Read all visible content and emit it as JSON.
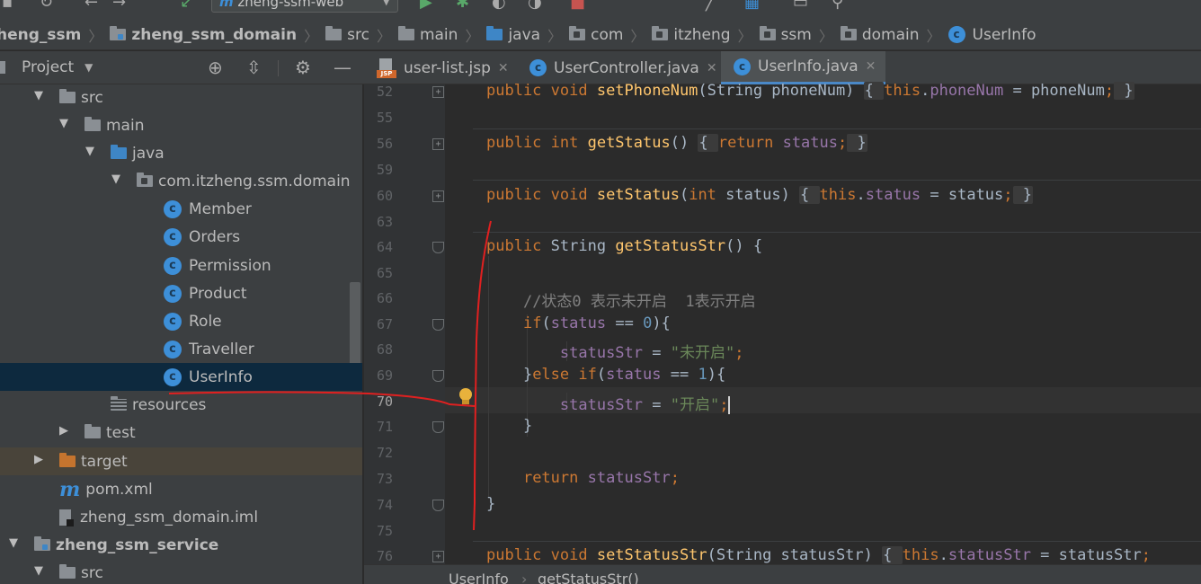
{
  "toolbar": {
    "run_config": "zheng-ssm-web",
    "run_config_logo": "m"
  },
  "breadcrumb": [
    {
      "label": "heng_ssm",
      "icon": "folder-module-icon",
      "bold": true
    },
    {
      "label": "zheng_ssm_domain",
      "icon": "folder-module-icon",
      "bold": true
    },
    {
      "label": "src",
      "icon": "folder-icon"
    },
    {
      "label": "main",
      "icon": "folder-icon"
    },
    {
      "label": "java",
      "icon": "folder-source-icon"
    },
    {
      "label": "com",
      "icon": "package-icon"
    },
    {
      "label": "itzheng",
      "icon": "package-icon"
    },
    {
      "label": "ssm",
      "icon": "package-icon"
    },
    {
      "label": "domain",
      "icon": "package-icon"
    },
    {
      "label": "UserInfo",
      "icon": "class-icon"
    }
  ],
  "project_panel": {
    "title": "Project",
    "icons": [
      "locate-icon",
      "collapse-all-icon",
      "gear-icon",
      "minimize-icon"
    ]
  },
  "tree": [
    {
      "label": "src",
      "indent": 1,
      "arrow": "down",
      "icon": "folder"
    },
    {
      "label": "main",
      "indent": 2,
      "arrow": "down",
      "icon": "folder"
    },
    {
      "label": "java",
      "indent": 3,
      "arrow": "down",
      "icon": "folder-blue"
    },
    {
      "label": "com.itzheng.ssm.domain",
      "indent": 4,
      "arrow": "down",
      "icon": "package"
    },
    {
      "label": "Member",
      "indent": 5,
      "icon": "class"
    },
    {
      "label": "Orders",
      "indent": 5,
      "icon": "class"
    },
    {
      "label": "Permission",
      "indent": 5,
      "icon": "class"
    },
    {
      "label": "Product",
      "indent": 5,
      "icon": "class"
    },
    {
      "label": "Role",
      "indent": 5,
      "icon": "class"
    },
    {
      "label": "Traveller",
      "indent": 5,
      "icon": "class"
    },
    {
      "label": "UserInfo",
      "indent": 5,
      "icon": "class",
      "selected": true
    },
    {
      "label": "resources",
      "indent": 3,
      "icon": "resources"
    },
    {
      "label": "test",
      "indent": 2,
      "arrow": "right",
      "icon": "folder"
    },
    {
      "label": "target",
      "indent": 1,
      "arrow": "right",
      "icon": "folder-orange",
      "highlight": true
    },
    {
      "label": "pom.xml",
      "indent": 1,
      "icon": "maven"
    },
    {
      "label": "zheng_ssm_domain.iml",
      "indent": 1,
      "icon": "iml"
    },
    {
      "label": "zheng_ssm_service",
      "indent": 0,
      "arrow": "down",
      "icon": "module",
      "bold": true
    },
    {
      "label": "src",
      "indent": 1,
      "arrow": "down",
      "icon": "folder"
    }
  ],
  "tabs": [
    {
      "label": "user-list.jsp",
      "icon": "jsp-icon",
      "badge": "JSP",
      "close": "✕"
    },
    {
      "label": "UserController.java",
      "icon": "class-icon",
      "close": "✕"
    },
    {
      "label": "UserInfo.java",
      "icon": "class-icon",
      "close": "✕",
      "active": true
    }
  ],
  "editor": {
    "current_line": "70",
    "lines": [
      {
        "num": "52",
        "fold": "+",
        "tokens": [
          [
            "k",
            "public void "
          ],
          [
            "m",
            "setPhoneNum"
          ],
          [
            "p",
            "(String phoneNum) "
          ],
          [
            "fr",
            "{ "
          ],
          [
            "k",
            "this"
          ],
          [
            "p",
            "."
          ],
          [
            "f",
            "phoneNum"
          ],
          [
            "p",
            " = phoneNum"
          ],
          [
            "k",
            ";"
          ],
          [
            "fr",
            " }"
          ]
        ]
      },
      {
        "num": "55",
        "tokens": []
      },
      {
        "num": "56",
        "fold": "+",
        "tokens": [
          [
            "k",
            "public int "
          ],
          [
            "m",
            "getStatus"
          ],
          [
            "p",
            "() "
          ],
          [
            "fr",
            "{ "
          ],
          [
            "k",
            "return "
          ],
          [
            "f",
            "status"
          ],
          [
            "k",
            ";"
          ],
          [
            "fr",
            " }"
          ]
        ]
      },
      {
        "num": "59",
        "tokens": []
      },
      {
        "num": "60",
        "fold": "+",
        "tokens": [
          [
            "k",
            "public void "
          ],
          [
            "m",
            "setStatus"
          ],
          [
            "p",
            "("
          ],
          [
            "k",
            "int "
          ],
          [
            "p",
            "status) "
          ],
          [
            "fr",
            "{ "
          ],
          [
            "k",
            "this"
          ],
          [
            "p",
            "."
          ],
          [
            "f",
            "status"
          ],
          [
            "p",
            " = status"
          ],
          [
            "k",
            ";"
          ],
          [
            "fr",
            " }"
          ]
        ]
      },
      {
        "num": "63",
        "tokens": []
      },
      {
        "num": "64",
        "fold": "-",
        "tokens": [
          [
            "k",
            "public "
          ],
          [
            "p",
            "String "
          ],
          [
            "m",
            "getStatusStr"
          ],
          [
            "p",
            "() {"
          ]
        ]
      },
      {
        "num": "65",
        "tokens": []
      },
      {
        "num": "66",
        "tokens": [
          [
            "p",
            "    "
          ],
          [
            "c",
            "//状态0 表示未开启  1表示开启"
          ]
        ]
      },
      {
        "num": "67",
        "fold": "-",
        "tokens": [
          [
            "p",
            "    "
          ],
          [
            "k",
            "if"
          ],
          [
            "p",
            "("
          ],
          [
            "f",
            "status"
          ],
          [
            "p",
            " == "
          ],
          [
            "n",
            "0"
          ],
          [
            "p",
            "){"
          ]
        ]
      },
      {
        "num": "68",
        "tokens": [
          [
            "p",
            "        "
          ],
          [
            "f",
            "statusStr"
          ],
          [
            "p",
            " = "
          ],
          [
            "s",
            "\"未开启\""
          ],
          [
            "k",
            ";"
          ]
        ]
      },
      {
        "num": "69",
        "fold": "-",
        "tokens": [
          [
            "p",
            "    }"
          ],
          [
            "k",
            "else if"
          ],
          [
            "p",
            "("
          ],
          [
            "f",
            "status"
          ],
          [
            "p",
            " == "
          ],
          [
            "n",
            "1"
          ],
          [
            "p",
            "){"
          ]
        ]
      },
      {
        "num": "70",
        "tokens": [
          [
            "p",
            "        "
          ],
          [
            "f",
            "statusStr"
          ],
          [
            "p",
            " = "
          ],
          [
            "s",
            "\"开启\""
          ],
          [
            "k",
            ";"
          ],
          [
            "caret",
            ""
          ]
        ]
      },
      {
        "num": "71",
        "fold": "-",
        "tokens": [
          [
            "p",
            "    }"
          ]
        ]
      },
      {
        "num": "72",
        "tokens": []
      },
      {
        "num": "73",
        "tokens": [
          [
            "p",
            "    "
          ],
          [
            "k",
            "return "
          ],
          [
            "f",
            "statusStr"
          ],
          [
            "k",
            ";"
          ]
        ]
      },
      {
        "num": "74",
        "fold": "-",
        "tokens": [
          [
            "p",
            "}"
          ]
        ]
      },
      {
        "num": "75",
        "tokens": []
      },
      {
        "num": "76",
        "fold": "+",
        "tokens": [
          [
            "k",
            "public void "
          ],
          [
            "m",
            "setStatusStr"
          ],
          [
            "p",
            "(String statusStr) "
          ],
          [
            "fr",
            "{ "
          ],
          [
            "k",
            "this"
          ],
          [
            "p",
            "."
          ],
          [
            "f",
            "statusStr"
          ],
          [
            "p",
            " = statusStr"
          ],
          [
            "k",
            ";"
          ]
        ]
      }
    ]
  },
  "status": {
    "crumb_class": "UserInfo",
    "separator": "›",
    "crumb_method": "getStatusStr()"
  },
  "colors": {
    "keyword": "#cc7832",
    "method": "#ffc66d",
    "field": "#9876aa",
    "string": "#6a8759",
    "number": "#6897bb",
    "comment": "#808080",
    "annotation_pen": "#e02020",
    "selection": "#0d293e"
  }
}
